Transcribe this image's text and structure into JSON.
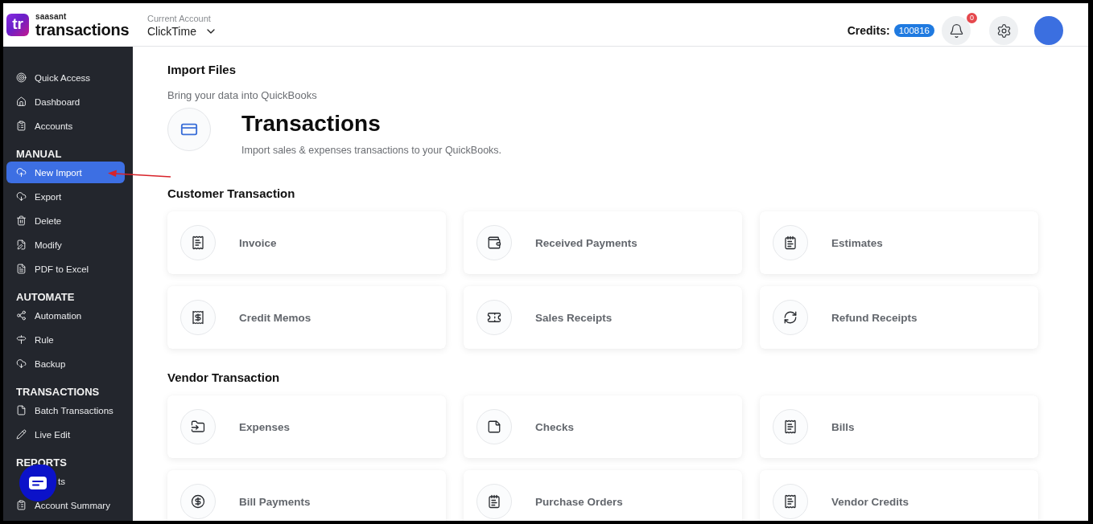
{
  "logo": {
    "mark": "tr",
    "brand": "saasant",
    "product": "transactions"
  },
  "account": {
    "label": "Current Account",
    "value": "ClickTime"
  },
  "credits": {
    "label": "Credits:",
    "value": "100816"
  },
  "notifications": {
    "count": "0"
  },
  "sidebar": {
    "sections": [
      {
        "items": [
          {
            "label": "Quick Access",
            "selected": false
          },
          {
            "label": "Dashboard",
            "selected": false
          },
          {
            "label": "Accounts",
            "selected": false
          }
        ]
      },
      {
        "heading": "MANUAL",
        "items": [
          {
            "label": "New Import",
            "selected": true
          },
          {
            "label": "Export",
            "selected": false
          },
          {
            "label": "Delete",
            "selected": false
          },
          {
            "label": "Modify",
            "selected": false
          },
          {
            "label": "PDF to Excel",
            "selected": false
          }
        ]
      },
      {
        "heading": "AUTOMATE",
        "items": [
          {
            "label": "Automation",
            "selected": false
          },
          {
            "label": "Rule",
            "selected": false
          },
          {
            "label": "Backup",
            "selected": false
          }
        ]
      },
      {
        "heading": "TRANSACTIONS",
        "items": [
          {
            "label": "Batch Transactions",
            "selected": false
          },
          {
            "label": "Live Edit",
            "selected": false
          }
        ]
      },
      {
        "heading": "REPORTS",
        "items": [
          {
            "label": "ts",
            "selected": false,
            "covered": true
          },
          {
            "label": "Account Summary",
            "selected": false
          }
        ]
      }
    ]
  },
  "page": {
    "title": "Import Files",
    "subtitle": "Bring your data into QuickBooks"
  },
  "feature": {
    "title": "Transactions",
    "description": "Import sales & expenses transactions to your QuickBooks."
  },
  "groups": [
    {
      "title": "Customer Transaction",
      "cards": [
        {
          "label": "Invoice"
        },
        {
          "label": "Received Payments"
        },
        {
          "label": "Estimates"
        },
        {
          "label": "Credit Memos"
        },
        {
          "label": "Sales Receipts"
        },
        {
          "label": "Refund Receipts"
        }
      ]
    },
    {
      "title": "Vendor Transaction",
      "cards": [
        {
          "label": "Expenses"
        },
        {
          "label": "Checks"
        },
        {
          "label": "Bills"
        },
        {
          "label": "Bill Payments"
        },
        {
          "label": "Purchase Orders"
        },
        {
          "label": "Vendor Credits"
        }
      ]
    }
  ]
}
